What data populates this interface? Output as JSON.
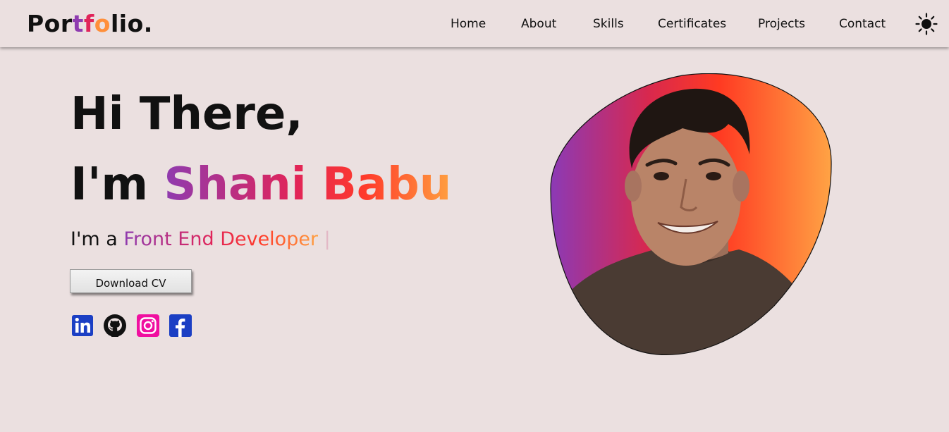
{
  "header": {
    "logo": {
      "part1": "Por",
      "letters": [
        "t",
        "f",
        "o"
      ],
      "part2": "lio."
    },
    "nav": [
      {
        "label": "Home"
      },
      {
        "label": "About"
      },
      {
        "label": "Skills"
      },
      {
        "label": "Certificates"
      },
      {
        "label": "Projects"
      },
      {
        "label": "Contact"
      }
    ],
    "theme_icon": "sun-icon"
  },
  "hero": {
    "greeting": "Hi There,",
    "intro_prefix": "I'm",
    "name": "Shani Babu",
    "role_prefix": "I'm a",
    "role": "Front End Developer",
    "caret": "|",
    "cv_button": "Download CV"
  },
  "social": [
    {
      "icon": "linkedin-icon",
      "color": "#1b3fc4"
    },
    {
      "icon": "github-icon",
      "color": "#111111"
    },
    {
      "icon": "instagram-icon",
      "color": "#f00fa0"
    },
    {
      "icon": "facebook-icon",
      "color": "#1b3fc4"
    }
  ],
  "colors": {
    "background": "#ebe0e0",
    "gradient": [
      "#8e3bb0",
      "#e0245a",
      "#ff3a2a",
      "#ffa040"
    ]
  }
}
